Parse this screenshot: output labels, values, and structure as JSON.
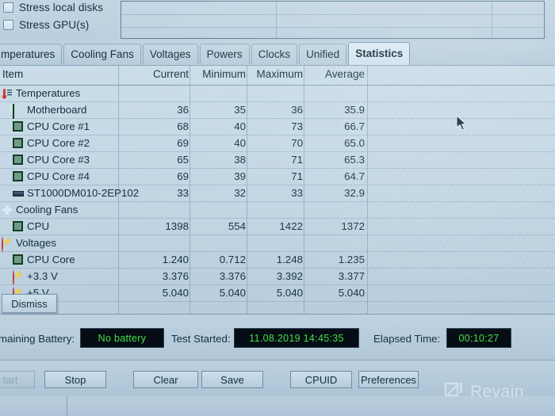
{
  "options": {
    "checkboxes": [
      {
        "label": "Stress local disks",
        "checked": false
      },
      {
        "label": "Stress GPU(s)",
        "checked": false
      }
    ]
  },
  "tabs": [
    {
      "label": "mperatures",
      "active": false
    },
    {
      "label": "Cooling Fans",
      "active": false
    },
    {
      "label": "Voltages",
      "active": false
    },
    {
      "label": "Powers",
      "active": false
    },
    {
      "label": "Clocks",
      "active": false
    },
    {
      "label": "Unified",
      "active": false
    },
    {
      "label": "Statistics",
      "active": true
    }
  ],
  "table": {
    "headers": {
      "item": "Item",
      "current": "Current",
      "minimum": "Minimum",
      "maximum": "Maximum",
      "average": "Average"
    },
    "rows": [
      {
        "type": "group",
        "icon": "thermometer-icon",
        "label": "Temperatures",
        "current": "",
        "minimum": "",
        "maximum": "",
        "average": ""
      },
      {
        "type": "leaf",
        "icon": "motherboard-icon",
        "label": "Motherboard",
        "current": "36",
        "minimum": "35",
        "maximum": "36",
        "average": "35.9"
      },
      {
        "type": "leaf",
        "icon": "cpu-core-icon",
        "label": "CPU Core #1",
        "current": "68",
        "minimum": "40",
        "maximum": "73",
        "average": "66.7"
      },
      {
        "type": "leaf",
        "icon": "cpu-core-icon",
        "label": "CPU Core #2",
        "current": "69",
        "minimum": "40",
        "maximum": "70",
        "average": "65.0"
      },
      {
        "type": "leaf",
        "icon": "cpu-core-icon",
        "label": "CPU Core #3",
        "current": "65",
        "minimum": "38",
        "maximum": "71",
        "average": "65.3"
      },
      {
        "type": "leaf",
        "icon": "cpu-core-icon",
        "label": "CPU Core #4",
        "current": "69",
        "minimum": "39",
        "maximum": "71",
        "average": "64.7"
      },
      {
        "type": "leaf",
        "icon": "harddisk-icon",
        "label": "ST1000DM010-2EP102",
        "current": "33",
        "minimum": "32",
        "maximum": "33",
        "average": "32.9"
      },
      {
        "type": "group",
        "icon": "fan-icon",
        "label": "Cooling Fans",
        "current": "",
        "minimum": "",
        "maximum": "",
        "average": ""
      },
      {
        "type": "leaf",
        "icon": "cpu-core-icon",
        "label": "CPU",
        "current": "1398",
        "minimum": "554",
        "maximum": "1422",
        "average": "1372"
      },
      {
        "type": "group",
        "icon": "voltage-icon",
        "label": "Voltages",
        "current": "",
        "minimum": "",
        "maximum": "",
        "average": ""
      },
      {
        "type": "leaf",
        "icon": "cpu-core-icon",
        "label": "CPU Core",
        "current": "1.240",
        "minimum": "0.712",
        "maximum": "1.248",
        "average": "1.235"
      },
      {
        "type": "leaf",
        "icon": "voltage-icon",
        "label": "+3.3 V",
        "current": "3.376",
        "minimum": "3.376",
        "maximum": "3.392",
        "average": "3.377"
      },
      {
        "type": "leaf",
        "icon": "voltage-icon",
        "label": "+5 V",
        "current": "5.040",
        "minimum": "5.040",
        "maximum": "5.040",
        "average": "5.040"
      }
    ]
  },
  "dismiss": {
    "label": "Dismiss"
  },
  "status": {
    "battery_label": "maining Battery:",
    "battery_value": "No battery",
    "started_label": "Test Started:",
    "started_value": "11.08.2019 14:45:35",
    "elapsed_label": "Elapsed Time:",
    "elapsed_value": "00:10:27"
  },
  "buttons": [
    {
      "id": "start",
      "label": "tart",
      "disabled": true
    },
    {
      "id": "stop",
      "label": "Stop",
      "disabled": false
    },
    {
      "id": "clear",
      "label": "Clear",
      "disabled": false
    },
    {
      "id": "save",
      "label": "Save",
      "disabled": false
    },
    {
      "id": "cpuid",
      "label": "CPUID",
      "disabled": false
    },
    {
      "id": "prefs",
      "label": "Preferences",
      "disabled": false
    }
  ],
  "watermark": {
    "text": "Revain"
  },
  "colors": {
    "lcd_background": "#060c14",
    "lcd_text": "#45e04a",
    "window_background": "#bacfde",
    "text": "#14303e",
    "active_tab": "#dceaf3"
  }
}
